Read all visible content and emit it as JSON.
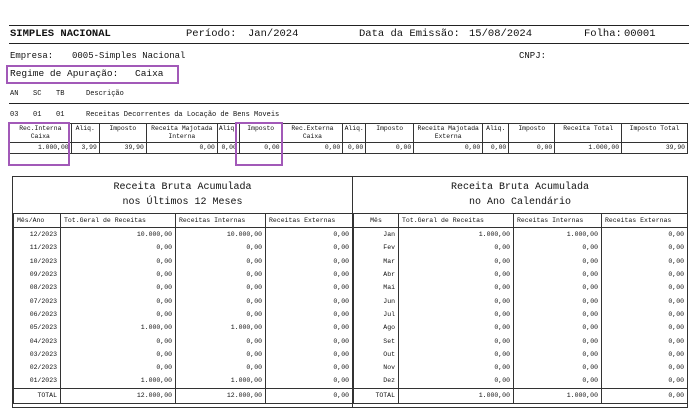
{
  "header": {
    "title": "SIMPLES NACIONAL",
    "periodo_label": "Período:",
    "periodo_value": "Jan/2024",
    "emissao_label": "Data da Emissão:",
    "emissao_value": "15/08/2024",
    "folha_label": "Folha:",
    "folha_value": "00001"
  },
  "empresa": {
    "label": "Empresa:",
    "value": "0005-Simples Nacional",
    "cnpj_label": "CNPJ:"
  },
  "regime": {
    "label": "Regime de Apuração:",
    "value": "Caixa"
  },
  "cols": {
    "an": "AN",
    "sc": "SC",
    "tb": "TB",
    "desc": "Descrição"
  },
  "activity": {
    "an": "03",
    "sc": "01",
    "tb": "01",
    "desc": "Receitas Decorrentes da Locação de Bens Moveis"
  },
  "summary": {
    "headers": [
      "Rec.Interna Caixa",
      "Aliq.",
      "Imposto",
      "Receita Majotada Interna",
      "Aliq.",
      "Imposto",
      "Rec.Externa Caixa",
      "Aliq.",
      "Imposto",
      "Receita Majotada Externa",
      "Aliq.",
      "Imposto",
      "Receita Total",
      "Imposto Total"
    ],
    "values": [
      "1.000,00",
      "3,99",
      "39,90",
      "0,00",
      "0,00",
      "0,00",
      "0,00",
      "0,00",
      "0,00",
      "0,00",
      "0,00",
      "0,00",
      "1.000,00",
      "39,90"
    ]
  },
  "left_panel": {
    "title_line1": "Receita Bruta Acumulada",
    "title_line2": "nos Últimos 12 Meses",
    "headers": [
      "Mês/Ano",
      "Tot.Geral de Receitas",
      "Receitas Internas",
      "Receitas Externas"
    ],
    "rows": [
      [
        "12/2023",
        "10.000,00",
        "10.000,00",
        "0,00"
      ],
      [
        "11/2023",
        "0,00",
        "0,00",
        "0,00"
      ],
      [
        "10/2023",
        "0,00",
        "0,00",
        "0,00"
      ],
      [
        "09/2023",
        "0,00",
        "0,00",
        "0,00"
      ],
      [
        "08/2023",
        "0,00",
        "0,00",
        "0,00"
      ],
      [
        "07/2023",
        "0,00",
        "0,00",
        "0,00"
      ],
      [
        "06/2023",
        "0,00",
        "0,00",
        "0,00"
      ],
      [
        "05/2023",
        "1.000,00",
        "1.000,00",
        "0,00"
      ],
      [
        "04/2023",
        "0,00",
        "0,00",
        "0,00"
      ],
      [
        "03/2023",
        "0,00",
        "0,00",
        "0,00"
      ],
      [
        "02/2023",
        "0,00",
        "0,00",
        "0,00"
      ],
      [
        "01/2023",
        "1.000,00",
        "1.000,00",
        "0,00"
      ]
    ],
    "total": [
      "TOTAL",
      "12.000,00",
      "12.000,00",
      "0,00"
    ]
  },
  "right_panel": {
    "title_line1": "Receita Bruta Acumulada",
    "title_line2": "no Ano Calendário",
    "headers": [
      "Mês",
      "Tot.Geral de Receitas",
      "Receitas Internas",
      "Receitas Externas"
    ],
    "rows": [
      [
        "Jan",
        "1.000,00",
        "1.000,00",
        "0,00"
      ],
      [
        "Fev",
        "0,00",
        "0,00",
        "0,00"
      ],
      [
        "Mar",
        "0,00",
        "0,00",
        "0,00"
      ],
      [
        "Abr",
        "0,00",
        "0,00",
        "0,00"
      ],
      [
        "Mai",
        "0,00",
        "0,00",
        "0,00"
      ],
      [
        "Jun",
        "0,00",
        "0,00",
        "0,00"
      ],
      [
        "Jul",
        "0,00",
        "0,00",
        "0,00"
      ],
      [
        "Ago",
        "0,00",
        "0,00",
        "0,00"
      ],
      [
        "Set",
        "0,00",
        "0,00",
        "0,00"
      ],
      [
        "Out",
        "0,00",
        "0,00",
        "0,00"
      ],
      [
        "Nov",
        "0,00",
        "0,00",
        "0,00"
      ],
      [
        "Dez",
        "0,00",
        "0,00",
        "0,00"
      ]
    ],
    "total": [
      "TOTAL",
      "1.000,00",
      "1.000,00",
      "0,00"
    ]
  },
  "colors": {
    "highlight": "#a259b8"
  }
}
